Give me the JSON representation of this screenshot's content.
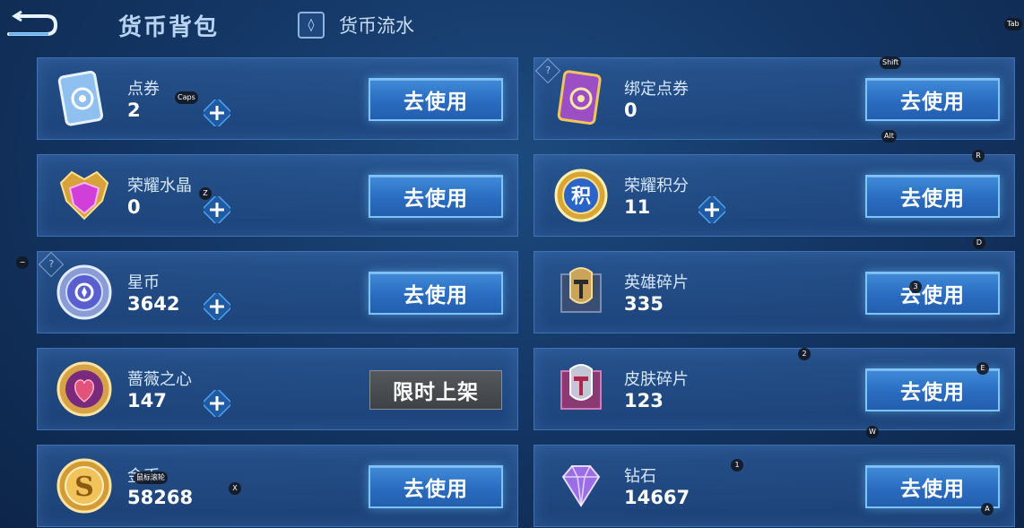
{
  "header": {
    "title": "货币背包",
    "flow_tab_label": "货币流水"
  },
  "cards": [
    {
      "name": "点券",
      "amount": "2",
      "action": "去使用",
      "icon": "ticket-card-icon",
      "plus": true
    },
    {
      "name": "绑定点券",
      "amount": "0",
      "action": "去使用",
      "icon": "bound-ticket-card-icon",
      "plus": false,
      "help": "?"
    },
    {
      "name": "荣耀水晶",
      "amount": "0",
      "action": "去使用",
      "icon": "glory-crystal-icon",
      "plus": true
    },
    {
      "name": "荣耀积分",
      "amount": "11",
      "action": "去使用",
      "icon": "glory-points-icon",
      "plus": true
    },
    {
      "name": "星币",
      "amount": "3642",
      "action": "去使用",
      "icon": "star-coin-icon",
      "plus": true,
      "help": "?"
    },
    {
      "name": "英雄碎片",
      "amount": "335",
      "action": "去使用",
      "icon": "hero-fragment-icon",
      "plus": false
    },
    {
      "name": "蔷薇之心",
      "amount": "147",
      "action": "限时上架",
      "icon": "rose-heart-icon",
      "plus": true
    },
    {
      "name": "皮肤碎片",
      "amount": "123",
      "action": "去使用",
      "icon": "skin-fragment-icon",
      "plus": false
    },
    {
      "name": "金币",
      "amount": "58268",
      "action": "去使用",
      "icon": "gold-coin-icon",
      "plus": false
    },
    {
      "name": "钻石",
      "amount": "14667",
      "action": "去使用",
      "icon": "diamond-icon",
      "plus": false
    }
  ],
  "key_hints": {
    "tab": "Tab",
    "shift": "Shift",
    "caps": "Caps",
    "alt": "Alt",
    "r": "R",
    "z": "Z",
    "d": "D",
    "minus": "−",
    "three": "3",
    "two": "2",
    "e": "E",
    "w": "W",
    "one": "1",
    "x": "X",
    "a": "A",
    "overlay": "鼠标滚轮"
  }
}
